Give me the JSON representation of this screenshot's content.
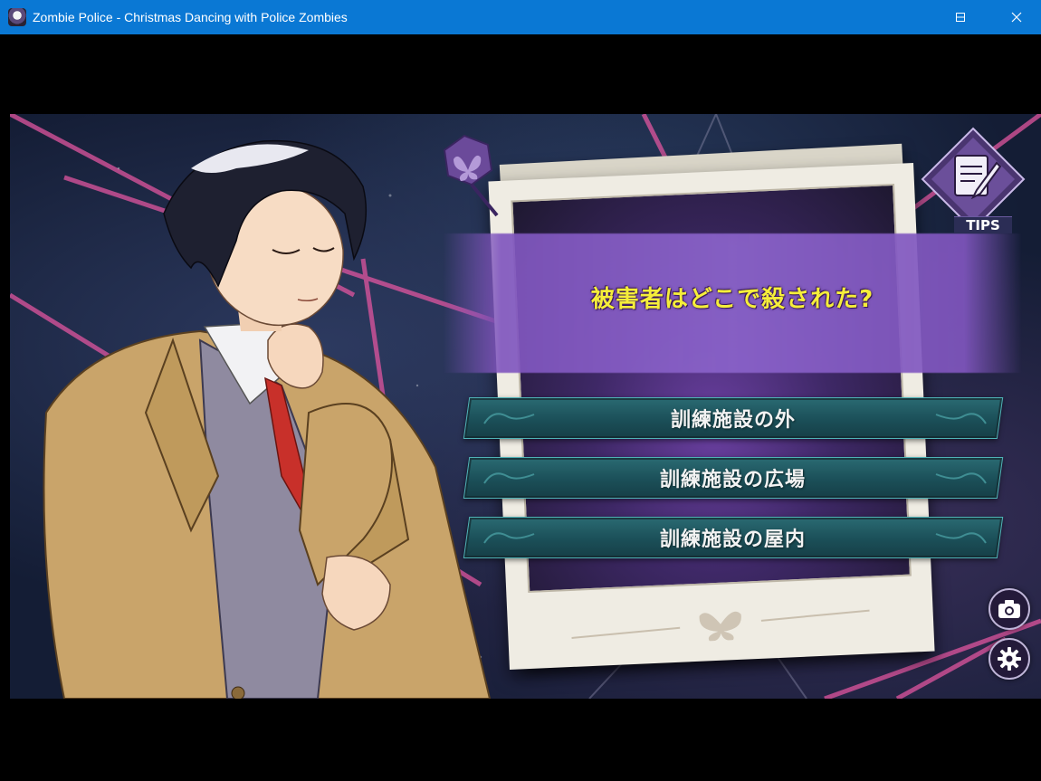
{
  "window": {
    "title": "Zombie Police - Christmas Dancing with Police Zombies",
    "controls": [
      "minimize",
      "maximize",
      "close"
    ]
  },
  "game": {
    "question": "被害者はどこで殺された?",
    "choices": [
      {
        "label": "訓練施設の外"
      },
      {
        "label": "訓練施設の広場"
      },
      {
        "label": "訓練施設の屋内"
      }
    ],
    "tips_label": "TIPS",
    "icons": {
      "pin": "butterfly-pin-icon",
      "tips": "notebook-pen-icon",
      "camera": "camera-icon",
      "settings": "gear-icon"
    },
    "colors": {
      "titlebar": "#0a78d4",
      "question_text": "#f5ee3a",
      "choice_bg": "#1b4f58",
      "choice_border": "#4fb3b6",
      "accent_lines": "#e0559f"
    }
  }
}
